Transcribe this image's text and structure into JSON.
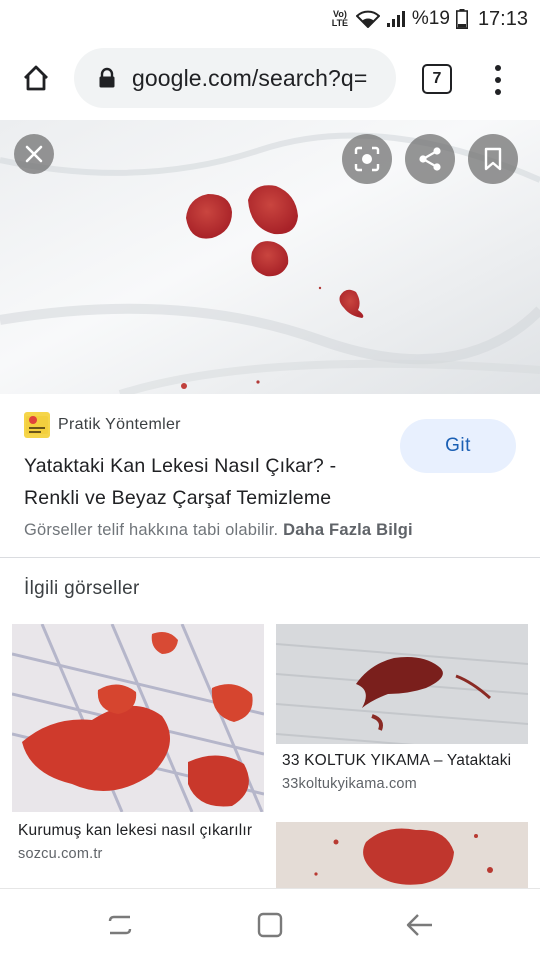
{
  "status_bar": {
    "volte": "Vo)\nLTE",
    "battery_pct": "%19",
    "time": "17:13"
  },
  "browser": {
    "url": "google.com/search?q=",
    "tab_count": "7",
    "icons": [
      "home-icon",
      "lock-icon",
      "tabs-icon",
      "more-vert-icon"
    ]
  },
  "viewer": {
    "icons": [
      "close-icon",
      "lens-icon",
      "share-icon",
      "bookmark-icon"
    ]
  },
  "result": {
    "source": "Pratik Yöntemler",
    "title": "Yataktaki Kan Lekesi Nasıl Çıkar? - Renkli ve Beyaz Çarşaf Temizleme",
    "visit_label": "Git",
    "copyright_text": "Görseller telif hakkına tabi olabilir.",
    "learn_more": "Daha Fazla Bilgi"
  },
  "related": {
    "heading": "İlgili görseller",
    "items": [
      {
        "title": "Kurumuş kan lekesi nasıl çıkarılır",
        "source": "sozcu.com.tr"
      },
      {
        "title": "33 KOLTUK YIKAMA – Yataktaki",
        "source": "33koltukyikama.com"
      },
      {
        "title": "",
        "source": ""
      }
    ]
  },
  "nav_bar": {
    "icons": [
      "recents-icon",
      "home-square-icon",
      "back-arrow-icon"
    ]
  },
  "colors": {
    "accent": "#1a5fb4",
    "visit_bg": "#e8f0fe",
    "blood": "#b5282a"
  }
}
